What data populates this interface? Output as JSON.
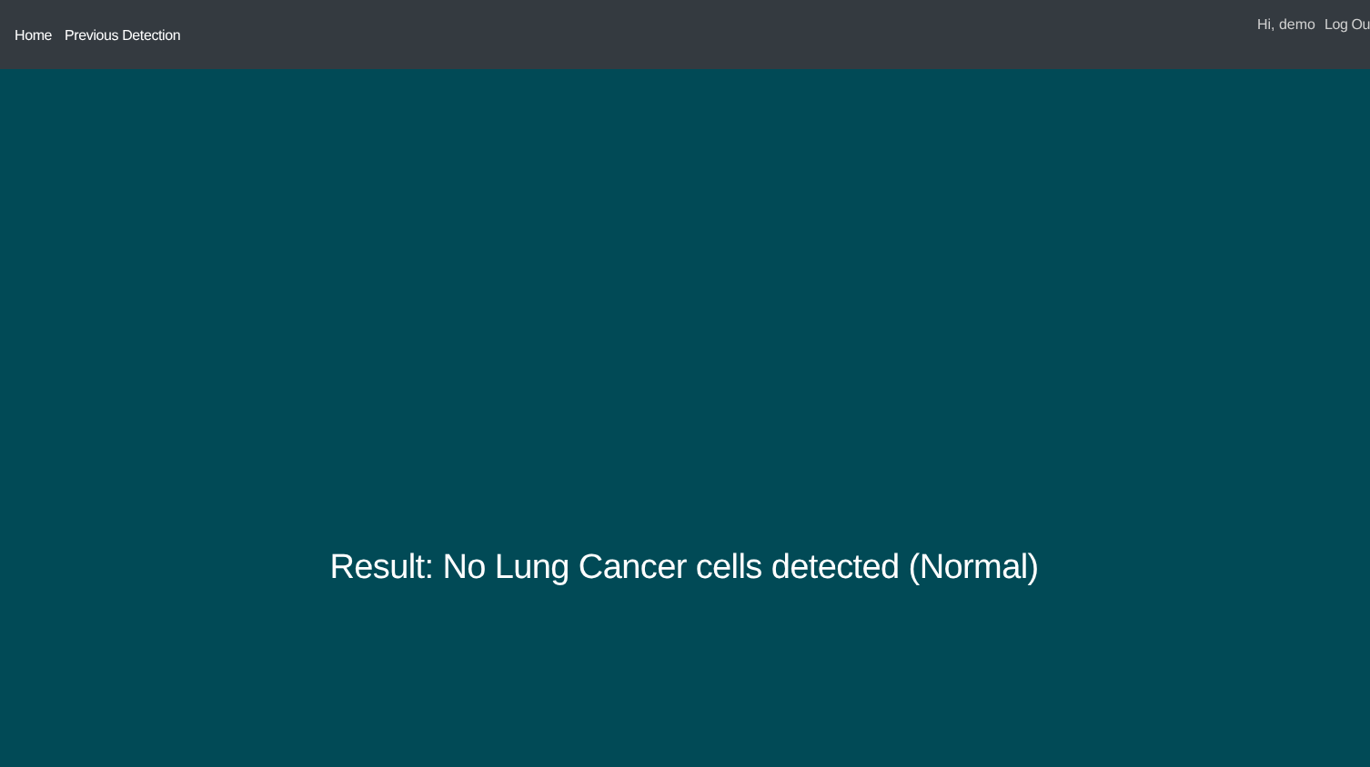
{
  "navbar": {
    "links": [
      {
        "label": "Home"
      },
      {
        "label": "Previous Detection"
      }
    ],
    "greeting": "Hi, demo",
    "logout": "Log Ou"
  },
  "result": {
    "text": "Result: No Lung Cancer cells detected (Normal)"
  }
}
